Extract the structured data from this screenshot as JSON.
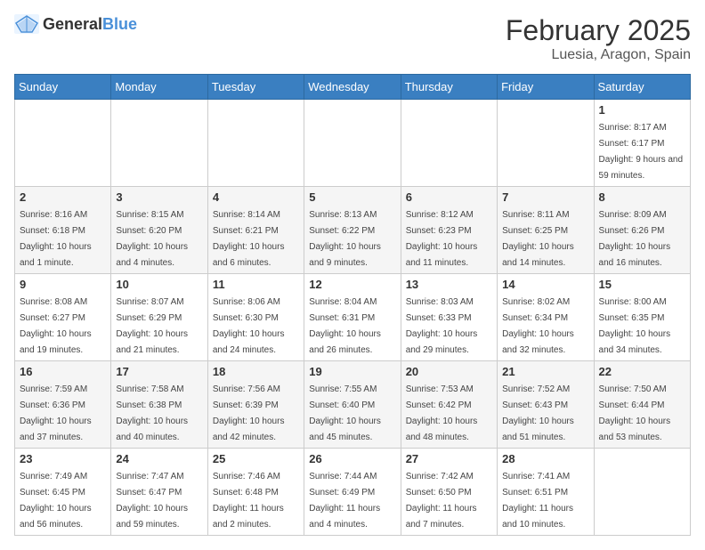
{
  "header": {
    "logo_general": "General",
    "logo_blue": "Blue",
    "month_title": "February 2025",
    "location": "Luesia, Aragon, Spain"
  },
  "weekdays": [
    "Sunday",
    "Monday",
    "Tuesday",
    "Wednesday",
    "Thursday",
    "Friday",
    "Saturday"
  ],
  "weeks": [
    [
      {
        "day": "",
        "info": ""
      },
      {
        "day": "",
        "info": ""
      },
      {
        "day": "",
        "info": ""
      },
      {
        "day": "",
        "info": ""
      },
      {
        "day": "",
        "info": ""
      },
      {
        "day": "",
        "info": ""
      },
      {
        "day": "1",
        "info": "Sunrise: 8:17 AM\nSunset: 6:17 PM\nDaylight: 9 hours and 59 minutes."
      }
    ],
    [
      {
        "day": "2",
        "info": "Sunrise: 8:16 AM\nSunset: 6:18 PM\nDaylight: 10 hours and 1 minute."
      },
      {
        "day": "3",
        "info": "Sunrise: 8:15 AM\nSunset: 6:20 PM\nDaylight: 10 hours and 4 minutes."
      },
      {
        "day": "4",
        "info": "Sunrise: 8:14 AM\nSunset: 6:21 PM\nDaylight: 10 hours and 6 minutes."
      },
      {
        "day": "5",
        "info": "Sunrise: 8:13 AM\nSunset: 6:22 PM\nDaylight: 10 hours and 9 minutes."
      },
      {
        "day": "6",
        "info": "Sunrise: 8:12 AM\nSunset: 6:23 PM\nDaylight: 10 hours and 11 minutes."
      },
      {
        "day": "7",
        "info": "Sunrise: 8:11 AM\nSunset: 6:25 PM\nDaylight: 10 hours and 14 minutes."
      },
      {
        "day": "8",
        "info": "Sunrise: 8:09 AM\nSunset: 6:26 PM\nDaylight: 10 hours and 16 minutes."
      }
    ],
    [
      {
        "day": "9",
        "info": "Sunrise: 8:08 AM\nSunset: 6:27 PM\nDaylight: 10 hours and 19 minutes."
      },
      {
        "day": "10",
        "info": "Sunrise: 8:07 AM\nSunset: 6:29 PM\nDaylight: 10 hours and 21 minutes."
      },
      {
        "day": "11",
        "info": "Sunrise: 8:06 AM\nSunset: 6:30 PM\nDaylight: 10 hours and 24 minutes."
      },
      {
        "day": "12",
        "info": "Sunrise: 8:04 AM\nSunset: 6:31 PM\nDaylight: 10 hours and 26 minutes."
      },
      {
        "day": "13",
        "info": "Sunrise: 8:03 AM\nSunset: 6:33 PM\nDaylight: 10 hours and 29 minutes."
      },
      {
        "day": "14",
        "info": "Sunrise: 8:02 AM\nSunset: 6:34 PM\nDaylight: 10 hours and 32 minutes."
      },
      {
        "day": "15",
        "info": "Sunrise: 8:00 AM\nSunset: 6:35 PM\nDaylight: 10 hours and 34 minutes."
      }
    ],
    [
      {
        "day": "16",
        "info": "Sunrise: 7:59 AM\nSunset: 6:36 PM\nDaylight: 10 hours and 37 minutes."
      },
      {
        "day": "17",
        "info": "Sunrise: 7:58 AM\nSunset: 6:38 PM\nDaylight: 10 hours and 40 minutes."
      },
      {
        "day": "18",
        "info": "Sunrise: 7:56 AM\nSunset: 6:39 PM\nDaylight: 10 hours and 42 minutes."
      },
      {
        "day": "19",
        "info": "Sunrise: 7:55 AM\nSunset: 6:40 PM\nDaylight: 10 hours and 45 minutes."
      },
      {
        "day": "20",
        "info": "Sunrise: 7:53 AM\nSunset: 6:42 PM\nDaylight: 10 hours and 48 minutes."
      },
      {
        "day": "21",
        "info": "Sunrise: 7:52 AM\nSunset: 6:43 PM\nDaylight: 10 hours and 51 minutes."
      },
      {
        "day": "22",
        "info": "Sunrise: 7:50 AM\nSunset: 6:44 PM\nDaylight: 10 hours and 53 minutes."
      }
    ],
    [
      {
        "day": "23",
        "info": "Sunrise: 7:49 AM\nSunset: 6:45 PM\nDaylight: 10 hours and 56 minutes."
      },
      {
        "day": "24",
        "info": "Sunrise: 7:47 AM\nSunset: 6:47 PM\nDaylight: 10 hours and 59 minutes."
      },
      {
        "day": "25",
        "info": "Sunrise: 7:46 AM\nSunset: 6:48 PM\nDaylight: 11 hours and 2 minutes."
      },
      {
        "day": "26",
        "info": "Sunrise: 7:44 AM\nSunset: 6:49 PM\nDaylight: 11 hours and 4 minutes."
      },
      {
        "day": "27",
        "info": "Sunrise: 7:42 AM\nSunset: 6:50 PM\nDaylight: 11 hours and 7 minutes."
      },
      {
        "day": "28",
        "info": "Sunrise: 7:41 AM\nSunset: 6:51 PM\nDaylight: 11 hours and 10 minutes."
      },
      {
        "day": "",
        "info": ""
      }
    ]
  ]
}
